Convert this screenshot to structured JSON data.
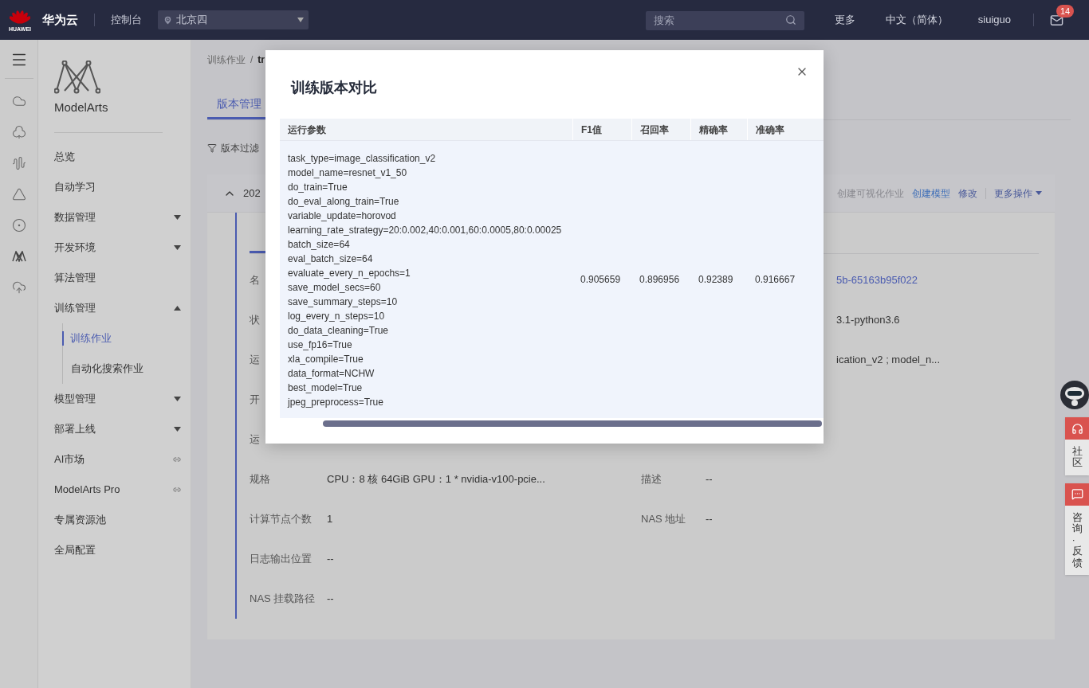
{
  "header": {
    "logo_text": "HUAWEI",
    "brand": "华为云",
    "console": "控制台",
    "region": "北京四",
    "search": {
      "placeholder": "搜索"
    },
    "links": [
      "更多",
      "中文（简体）",
      "siuiguo"
    ],
    "mail_badge": "14"
  },
  "sidebar": {
    "product": "ModelArts",
    "items": [
      {
        "label": "总览",
        "kind": "plain"
      },
      {
        "label": "自动学习",
        "kind": "plain"
      },
      {
        "label": "数据管理",
        "kind": "group",
        "expanded": false
      },
      {
        "label": "开发环境",
        "kind": "group",
        "expanded": false
      },
      {
        "label": "算法管理",
        "kind": "plain"
      },
      {
        "label": "训练管理",
        "kind": "group",
        "expanded": true,
        "children": [
          {
            "label": "训练作业",
            "selected": true
          },
          {
            "label": "自动化搜索作业",
            "selected": false
          }
        ]
      },
      {
        "label": "模型管理",
        "kind": "group",
        "expanded": false
      },
      {
        "label": "部署上线",
        "kind": "group",
        "expanded": false
      },
      {
        "label": "AI市场",
        "kind": "external"
      },
      {
        "label": "ModelArts Pro",
        "kind": "external"
      },
      {
        "label": "专属资源池",
        "kind": "plain"
      },
      {
        "label": "全局配置",
        "kind": "plain"
      }
    ]
  },
  "breadcrumb": {
    "items": [
      "训练作业",
      "tr"
    ],
    "separator": "/"
  },
  "tabs": [
    {
      "label": "版本管理",
      "selected": true
    }
  ],
  "filter": "版本过滤",
  "version_card": {
    "title": "202",
    "expanded": true,
    "actions": [
      {
        "label": "创建可视化作业",
        "kind": "disabled"
      },
      {
        "label": "创建模型",
        "kind": "primary"
      },
      {
        "label": "修改",
        "kind": "link"
      },
      {
        "label": "更多操作",
        "kind": "menu"
      }
    ],
    "subtabs": [
      {
        "selected": true
      }
    ],
    "covered_rows": [
      {
        "label": "名",
        "value": "5b-65163b95f022",
        "kind": "link"
      },
      {
        "label": "状",
        "value": "3.1-python3.6",
        "kind": "text"
      },
      {
        "label": "运",
        "value": "ication_v2 ; model_n...",
        "kind": "text"
      },
      {
        "label": "开"
      },
      {
        "label": "运"
      }
    ],
    "rows": [
      {
        "label": "规格",
        "value": "CPU：8 核 64GiB GPU：1 * nvidia-v100-pcie...",
        "label_2": "描述",
        "value_2": "--"
      },
      {
        "label": "计算节点个数",
        "value": "1",
        "label_2": "NAS 地址",
        "value_2": "--"
      },
      {
        "label": "日志输出位置",
        "value": "--"
      },
      {
        "label": "NAS 挂载路径",
        "value": "--"
      }
    ]
  },
  "dialog": {
    "title": "训练版本对比",
    "table": {
      "columns": [
        "运行参数",
        "F1值",
        "召回率",
        "精确率",
        "准确率"
      ],
      "rows": [
        {
          "params": [
            "task_type=image_classification_v2",
            "model_name=resnet_v1_50",
            "do_train=True",
            "do_eval_along_train=True",
            "variable_update=horovod",
            "learning_rate_strategy=20:0.002,40:0.001,60:0.0005,80:0.00025",
            "batch_size=64",
            "eval_batch_size=64",
            "evaluate_every_n_epochs=1",
            "save_model_secs=60",
            "save_summary_steps=10",
            "log_every_n_steps=10",
            "do_data_cleaning=True",
            "use_fp16=True",
            "xla_compile=True",
            "data_format=NCHW",
            "best_model=True",
            "jpeg_preprocess=True"
          ],
          "values": [
            "0.905659",
            "0.896956",
            "0.92389",
            "0.916667"
          ]
        }
      ]
    }
  },
  "float_buttons": [
    {
      "label": "社区",
      "kind": "community"
    },
    {
      "label": "咨询·反馈",
      "kind": "feedback"
    }
  ]
}
